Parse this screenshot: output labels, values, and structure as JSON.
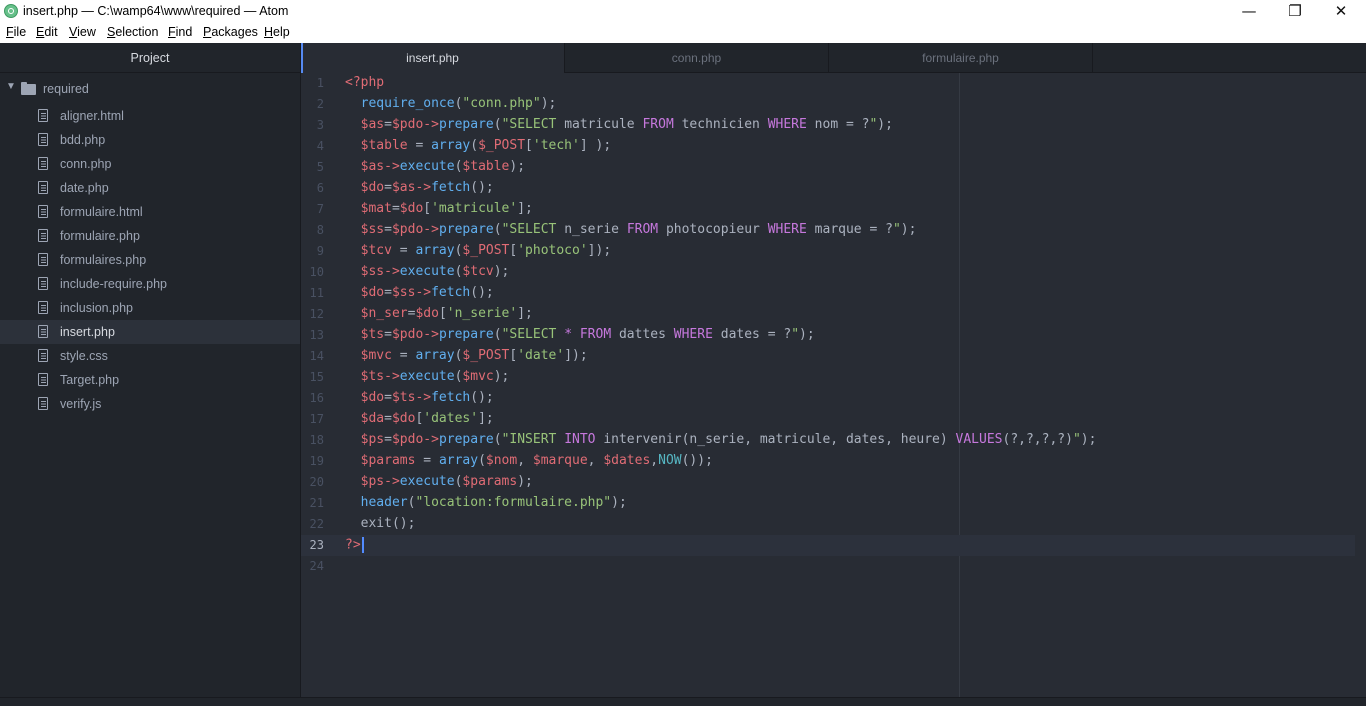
{
  "window": {
    "title": "insert.php — C:\\wamp64\\www\\required — Atom",
    "minimize": "—",
    "maximize": "❐",
    "close": "✕"
  },
  "menu": [
    {
      "label": "File",
      "accel": "F",
      "rest": "ile"
    },
    {
      "label": "Edit",
      "accel": "E",
      "rest": "dit"
    },
    {
      "label": "View",
      "accel": "V",
      "rest": "iew"
    },
    {
      "label": "Selection",
      "accel": "S",
      "rest": "election"
    },
    {
      "label": "Find",
      "accel": "F",
      "rest": "ind"
    },
    {
      "label": "Packages",
      "accel": "P",
      "rest": "ackages"
    },
    {
      "label": "Help",
      "accel": "H",
      "rest": "elp"
    }
  ],
  "sidebar": {
    "title": "Project",
    "root": "required",
    "files": [
      "aligner.html",
      "bdd.php",
      "conn.php",
      "date.php",
      "formulaire.html",
      "formulaire.php",
      "formulaires.php",
      "include-require.php",
      "inclusion.php",
      "insert.php",
      "style.css",
      "Target.php",
      "verify.js"
    ],
    "selected": "insert.php"
  },
  "tabs": [
    {
      "label": "insert.php",
      "active": true
    },
    {
      "label": "conn.php",
      "active": false
    },
    {
      "label": "formulaire.php",
      "active": false
    }
  ],
  "editor": {
    "cursor_line": 23,
    "lines": [
      {
        "n": "1",
        "tokens": [
          [
            "tag",
            "<?php"
          ]
        ]
      },
      {
        "n": "2",
        "tokens": [
          [
            "id",
            "  "
          ],
          [
            "fn",
            "require_once"
          ],
          [
            "id",
            "("
          ],
          [
            "str",
            "\"conn.php\""
          ],
          [
            "id",
            ");"
          ]
        ]
      },
      {
        "n": "3",
        "tokens": [
          [
            "id",
            "  "
          ],
          [
            "var",
            "$as"
          ],
          [
            "id",
            "="
          ],
          [
            "var",
            "$pdo"
          ],
          [
            "var",
            "->"
          ],
          [
            "fn",
            "prepare"
          ],
          [
            "id",
            "("
          ],
          [
            "str",
            "\"SELECT "
          ],
          [
            "id",
            "matricule "
          ],
          [
            "kw",
            "FROM"
          ],
          [
            "id",
            " technicien "
          ],
          [
            "kw",
            "WHERE"
          ],
          [
            "id",
            " nom = ?"
          ],
          [
            "str",
            "\""
          ],
          [
            "id",
            ");"
          ]
        ]
      },
      {
        "n": "4",
        "tokens": [
          [
            "id",
            "  "
          ],
          [
            "var",
            "$table"
          ],
          [
            "id",
            " = "
          ],
          [
            "fn",
            "array"
          ],
          [
            "id",
            "("
          ],
          [
            "var",
            "$_POST"
          ],
          [
            "id",
            "["
          ],
          [
            "str",
            "'tech'"
          ],
          [
            "id",
            "] );"
          ]
        ]
      },
      {
        "n": "5",
        "tokens": [
          [
            "id",
            "  "
          ],
          [
            "var",
            "$as"
          ],
          [
            "var",
            "->"
          ],
          [
            "fn",
            "execute"
          ],
          [
            "id",
            "("
          ],
          [
            "var",
            "$table"
          ],
          [
            "id",
            ");"
          ]
        ]
      },
      {
        "n": "6",
        "tokens": [
          [
            "id",
            "  "
          ],
          [
            "var",
            "$do"
          ],
          [
            "id",
            "="
          ],
          [
            "var",
            "$as"
          ],
          [
            "var",
            "->"
          ],
          [
            "fn",
            "fetch"
          ],
          [
            "id",
            "();"
          ]
        ]
      },
      {
        "n": "7",
        "tokens": [
          [
            "id",
            "  "
          ],
          [
            "var",
            "$mat"
          ],
          [
            "id",
            "="
          ],
          [
            "var",
            "$do"
          ],
          [
            "id",
            "["
          ],
          [
            "str",
            "'matricule'"
          ],
          [
            "id",
            "];"
          ]
        ]
      },
      {
        "n": "8",
        "tokens": [
          [
            "id",
            "  "
          ],
          [
            "var",
            "$ss"
          ],
          [
            "id",
            "="
          ],
          [
            "var",
            "$pdo"
          ],
          [
            "var",
            "->"
          ],
          [
            "fn",
            "prepare"
          ],
          [
            "id",
            "("
          ],
          [
            "str",
            "\"SELECT "
          ],
          [
            "id",
            "n_serie "
          ],
          [
            "kw",
            "FROM"
          ],
          [
            "id",
            " photocopieur "
          ],
          [
            "kw",
            "WHERE"
          ],
          [
            "id",
            " marque = ?"
          ],
          [
            "str",
            "\""
          ],
          [
            "id",
            ");"
          ]
        ]
      },
      {
        "n": "9",
        "tokens": [
          [
            "id",
            "  "
          ],
          [
            "var",
            "$tcv"
          ],
          [
            "id",
            " = "
          ],
          [
            "fn",
            "array"
          ],
          [
            "id",
            "("
          ],
          [
            "var",
            "$_POST"
          ],
          [
            "id",
            "["
          ],
          [
            "str",
            "'photoco'"
          ],
          [
            "id",
            "]);"
          ]
        ]
      },
      {
        "n": "10",
        "tokens": [
          [
            "id",
            "  "
          ],
          [
            "var",
            "$ss"
          ],
          [
            "var",
            "->"
          ],
          [
            "fn",
            "execute"
          ],
          [
            "id",
            "("
          ],
          [
            "var",
            "$tcv"
          ],
          [
            "id",
            ");"
          ]
        ]
      },
      {
        "n": "11",
        "tokens": [
          [
            "id",
            "  "
          ],
          [
            "var",
            "$do"
          ],
          [
            "id",
            "="
          ],
          [
            "var",
            "$ss"
          ],
          [
            "var",
            "->"
          ],
          [
            "fn",
            "fetch"
          ],
          [
            "id",
            "();"
          ]
        ]
      },
      {
        "n": "12",
        "tokens": [
          [
            "id",
            "  "
          ],
          [
            "var",
            "$n_ser"
          ],
          [
            "id",
            "="
          ],
          [
            "var",
            "$do"
          ],
          [
            "id",
            "["
          ],
          [
            "str",
            "'n_serie'"
          ],
          [
            "id",
            "];"
          ]
        ]
      },
      {
        "n": "13",
        "tokens": [
          [
            "id",
            "  "
          ],
          [
            "var",
            "$ts"
          ],
          [
            "id",
            "="
          ],
          [
            "var",
            "$pdo"
          ],
          [
            "var",
            "->"
          ],
          [
            "fn",
            "prepare"
          ],
          [
            "id",
            "("
          ],
          [
            "str",
            "\"SELECT "
          ],
          [
            "kw",
            "*"
          ],
          [
            "id",
            " "
          ],
          [
            "kw",
            "FROM"
          ],
          [
            "id",
            " dattes "
          ],
          [
            "kw",
            "WHERE"
          ],
          [
            "id",
            " dates = ?"
          ],
          [
            "str",
            "\""
          ],
          [
            "id",
            ");"
          ]
        ]
      },
      {
        "n": "14",
        "tokens": [
          [
            "id",
            "  "
          ],
          [
            "var",
            "$mvc"
          ],
          [
            "id",
            " = "
          ],
          [
            "fn",
            "array"
          ],
          [
            "id",
            "("
          ],
          [
            "var",
            "$_POST"
          ],
          [
            "id",
            "["
          ],
          [
            "str",
            "'date'"
          ],
          [
            "id",
            "]);"
          ]
        ]
      },
      {
        "n": "15",
        "tokens": [
          [
            "id",
            "  "
          ],
          [
            "var",
            "$ts"
          ],
          [
            "var",
            "->"
          ],
          [
            "fn",
            "execute"
          ],
          [
            "id",
            "("
          ],
          [
            "var",
            "$mvc"
          ],
          [
            "id",
            ");"
          ]
        ]
      },
      {
        "n": "16",
        "tokens": [
          [
            "id",
            "  "
          ],
          [
            "var",
            "$do"
          ],
          [
            "id",
            "="
          ],
          [
            "var",
            "$ts"
          ],
          [
            "var",
            "->"
          ],
          [
            "fn",
            "fetch"
          ],
          [
            "id",
            "();"
          ]
        ]
      },
      {
        "n": "17",
        "tokens": [
          [
            "id",
            "  "
          ],
          [
            "var",
            "$da"
          ],
          [
            "id",
            "="
          ],
          [
            "var",
            "$do"
          ],
          [
            "id",
            "["
          ],
          [
            "str",
            "'dates'"
          ],
          [
            "id",
            "];"
          ]
        ]
      },
      {
        "n": "18",
        "tokens": [
          [
            "id",
            "  "
          ],
          [
            "var",
            "$ps"
          ],
          [
            "id",
            "="
          ],
          [
            "var",
            "$pdo"
          ],
          [
            "var",
            "->"
          ],
          [
            "fn",
            "prepare"
          ],
          [
            "id",
            "("
          ],
          [
            "str",
            "\"INSERT "
          ],
          [
            "kw",
            "INTO"
          ],
          [
            "id",
            " intervenir(n_serie, matricule, dates, heure) "
          ],
          [
            "kw",
            "VALUES"
          ],
          [
            "id",
            "(?,?,?,?)"
          ],
          [
            "str",
            "\""
          ],
          [
            "id",
            ");"
          ]
        ]
      },
      {
        "n": "19",
        "tokens": [
          [
            "id",
            "  "
          ],
          [
            "var",
            "$params"
          ],
          [
            "id",
            " = "
          ],
          [
            "fn",
            "array"
          ],
          [
            "id",
            "("
          ],
          [
            "var",
            "$nom"
          ],
          [
            "id",
            ", "
          ],
          [
            "var",
            "$marque"
          ],
          [
            "id",
            ", "
          ],
          [
            "var",
            "$dates"
          ],
          [
            "id",
            ","
          ],
          [
            "bi",
            "NOW"
          ],
          [
            "id",
            "());"
          ]
        ]
      },
      {
        "n": "20",
        "tokens": [
          [
            "id",
            "  "
          ],
          [
            "var",
            "$ps"
          ],
          [
            "var",
            "->"
          ],
          [
            "fn",
            "execute"
          ],
          [
            "id",
            "("
          ],
          [
            "var",
            "$params"
          ],
          [
            "id",
            ");"
          ]
        ]
      },
      {
        "n": "21",
        "tokens": [
          [
            "id",
            "  "
          ],
          [
            "fn",
            "header"
          ],
          [
            "id",
            "("
          ],
          [
            "str",
            "\"location:formulaire.php\""
          ],
          [
            "id",
            ");"
          ]
        ]
      },
      {
        "n": "22",
        "tokens": [
          [
            "id",
            "  exit();"
          ]
        ]
      },
      {
        "n": "23",
        "tokens": [
          [
            "tag",
            "?>"
          ]
        ]
      },
      {
        "n": "24",
        "tokens": []
      }
    ]
  }
}
